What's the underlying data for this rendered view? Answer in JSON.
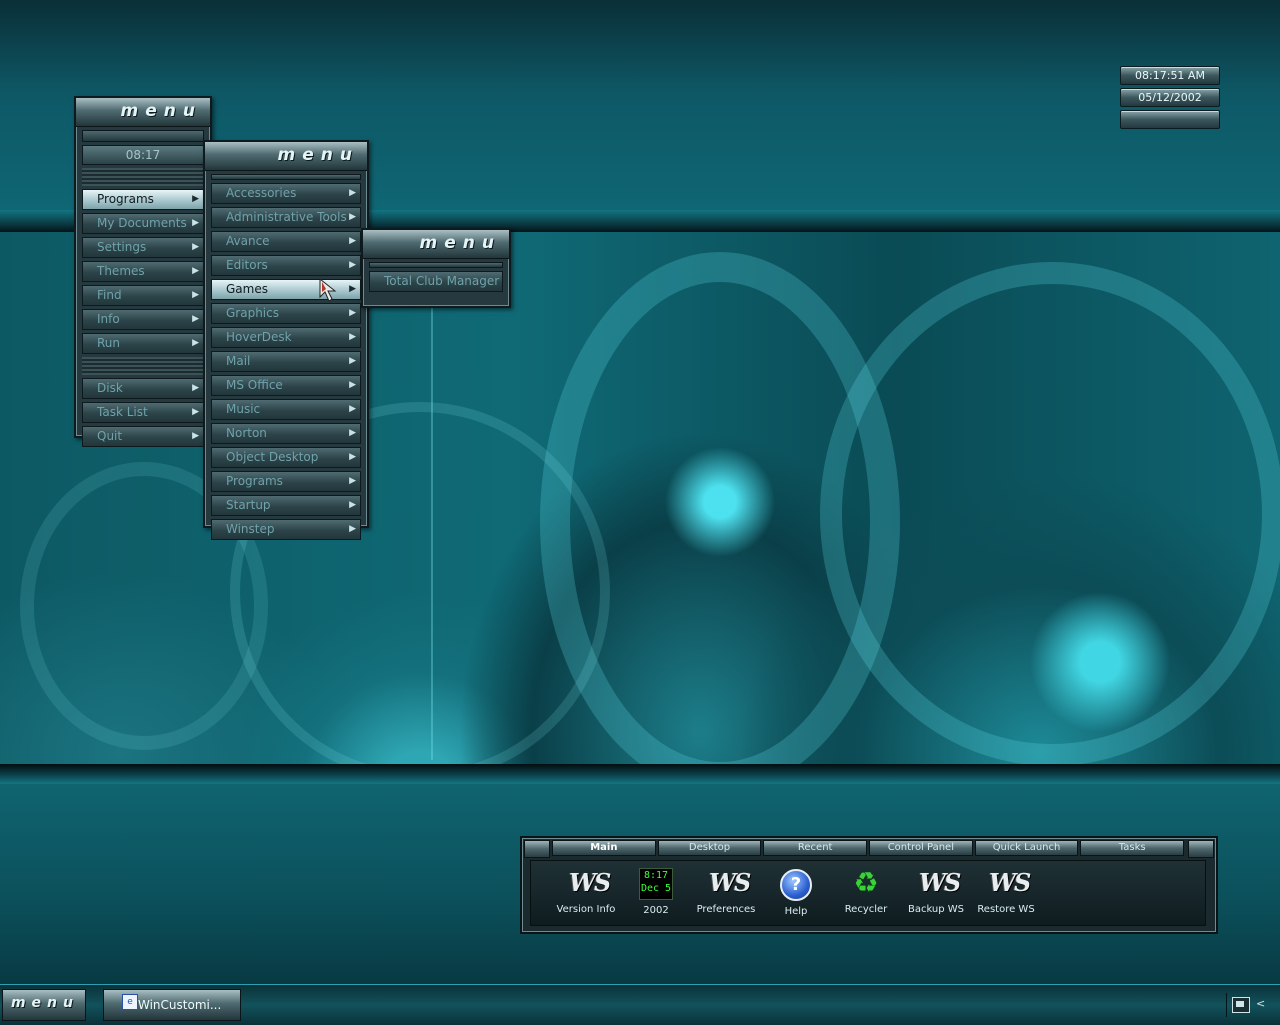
{
  "clock": {
    "time": "08:17:51 AM",
    "date": "05/12/2002",
    "extra": ""
  },
  "menu1": {
    "logo": "menu",
    "time": "08:17",
    "items": [
      {
        "label": "Programs",
        "selected": true
      },
      {
        "label": "My Documents"
      },
      {
        "label": "Settings"
      },
      {
        "label": "Themes"
      },
      {
        "label": "Find"
      },
      {
        "label": "Info"
      },
      {
        "label": "Run"
      }
    ],
    "items2": [
      {
        "label": "Disk"
      },
      {
        "label": "Task List"
      },
      {
        "label": "Quit"
      }
    ]
  },
  "menu2": {
    "logo": "menu",
    "items": [
      {
        "label": "Accessories"
      },
      {
        "label": "Administrative Tools"
      },
      {
        "label": "Avance"
      },
      {
        "label": "Editors"
      },
      {
        "label": "Games",
        "selected": true
      },
      {
        "label": "Graphics"
      },
      {
        "label": "HoverDesk"
      },
      {
        "label": "Mail"
      },
      {
        "label": "MS Office"
      },
      {
        "label": "Music"
      },
      {
        "label": "Norton"
      },
      {
        "label": "Object Desktop"
      },
      {
        "label": "Programs"
      },
      {
        "label": "Startup"
      },
      {
        "label": "Winstep"
      }
    ]
  },
  "menu3": {
    "logo": "menu",
    "items": [
      {
        "label": "Total Club Manager"
      }
    ]
  },
  "dock": {
    "tabs": [
      "Main",
      "Desktop",
      "Recent",
      "Control Panel",
      "Quick Launch",
      "Tasks"
    ],
    "active_tab": "Main",
    "items": [
      {
        "label": "Version Info",
        "icon": "ws-logo-icon"
      },
      {
        "label": "2002",
        "icon": "calendar-icon",
        "cal_time": "8:17",
        "cal_date": "Dec 5"
      },
      {
        "label": "Preferences",
        "icon": "ws-logo-icon"
      },
      {
        "label": "Help",
        "icon": "help-icon"
      },
      {
        "label": "Recycler",
        "icon": "recycle-icon"
      },
      {
        "label": "Backup WS",
        "icon": "ws-logo-icon"
      },
      {
        "label": "Restore WS",
        "icon": "ws-logo-icon"
      }
    ]
  },
  "taskbar": {
    "start_logo": "menu",
    "window_button": "WinCustomi..."
  },
  "colors": {
    "accent": "#0f6674",
    "selected_item": "#a8c8ce",
    "dock_bg": "#1a2a2e"
  }
}
